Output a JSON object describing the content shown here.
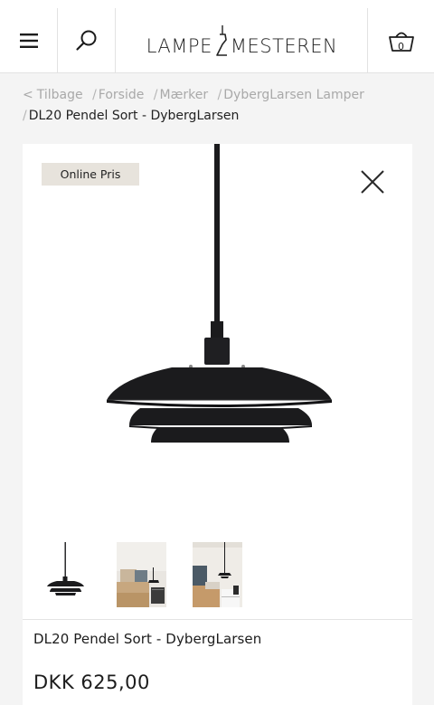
{
  "header": {
    "menu_icon": "hamburger-icon",
    "search_icon": "search-icon",
    "logo_left": "LAMPE",
    "logo_right": "MESTEREN",
    "basket_icon": "basket-icon",
    "basket_count": "0"
  },
  "breadcrumb": {
    "back_label": "Tilbage",
    "items": [
      "Forside",
      "Mærker",
      "DybergLarsen Lamper"
    ],
    "current": "DL20 Pendel Sort - DybergLarsen"
  },
  "product": {
    "badge": "Online Pris",
    "close_icon": "close-icon",
    "title": "DL20 Pendel Sort - DybergLarsen",
    "price": "DKK 625,00",
    "thumbnails": [
      "lamp-product-thumbnail",
      "bedroom-scene-thumbnail",
      "bedroom-lamp-thumbnail"
    ]
  },
  "colors": {
    "page_bg": "#f4f4f4",
    "badge_bg": "#e7e3dc",
    "lamp": "#1b1b1d"
  }
}
